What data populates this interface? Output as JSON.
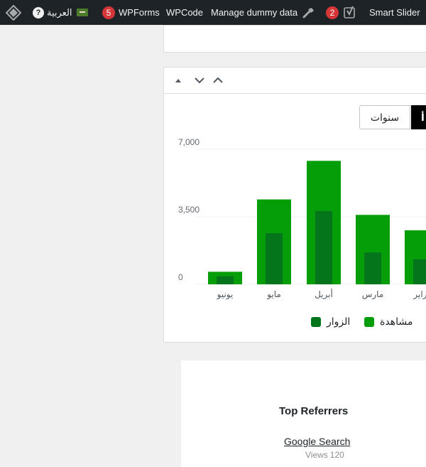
{
  "adminbar": {
    "smart_slider": "Smart Slider",
    "yoast_count": "2",
    "manage_dummy": "Manage dummy data",
    "wpcode": "WPCode",
    "wpforms": "WPForms",
    "wpforms_count": "5",
    "language": "العربية"
  },
  "stats": {
    "tabs": {
      "years": "سنوات",
      "active": "أ"
    },
    "legend": {
      "views": "مشاهدة",
      "visitors": "الزوار"
    }
  },
  "chart_data": {
    "type": "bar",
    "categories": [
      "فبراير",
      "مارس",
      "أبريل",
      "مايو",
      "يونيو"
    ],
    "visible_category_labels": [
      "براير",
      "مارس",
      "أبريل",
      "مايو",
      "يونيو"
    ],
    "series": [
      {
        "name": "مشاهدة",
        "values": [
          2800,
          3600,
          6400,
          4400,
          650
        ],
        "color": "#069e08"
      },
      {
        "name": "الزوار",
        "values": [
          1300,
          1650,
          3800,
          2650,
          420
        ],
        "color": "#04751a"
      }
    ],
    "y_ticks": [
      "0",
      "3,500",
      "7,000"
    ],
    "ylim": [
      0,
      7000
    ],
    "grid": true,
    "legend_position": "bottom"
  },
  "referrers": {
    "title": "Top Referrers",
    "item": {
      "label": "Google Search",
      "views_label": "Views",
      "views": "120"
    }
  }
}
